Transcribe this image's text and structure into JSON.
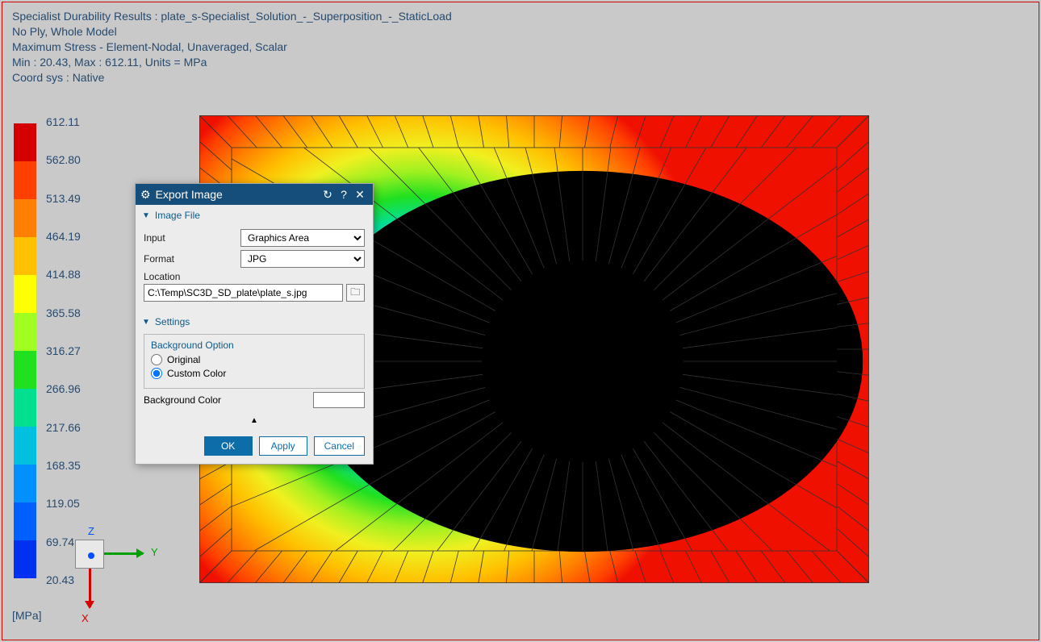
{
  "header": {
    "line1": "Specialist Durability Results : plate_s-Specialist_Solution_-_Superposition_-_StaticLoad",
    "line2": "No Ply, Whole Model",
    "line3": "Maximum Stress - Element-Nodal, Unaveraged, Scalar",
    "line4": "Min : 20.43, Max : 612.11, Units = MPa",
    "line5": "Coord sys : Native"
  },
  "legend": {
    "unit": "[MPa]",
    "values": [
      "612.11",
      "562.80",
      "513.49",
      "464.19",
      "414.88",
      "365.58",
      "316.27",
      "266.96",
      "217.66",
      "168.35",
      "119.05",
      "69.74",
      "20.43"
    ],
    "colors": [
      "#d40000",
      "#ff4000",
      "#ff8000",
      "#ffc000",
      "#ffff00",
      "#a0ff20",
      "#20e020",
      "#00e090",
      "#00c0e0",
      "#0090ff",
      "#0060ff",
      "#0030f0"
    ]
  },
  "triad": {
    "x": "X",
    "y": "Y",
    "z": "Z"
  },
  "dialog": {
    "title": "Export Image",
    "sections": {
      "imageFile": "Image File",
      "settings": "Settings"
    },
    "fields": {
      "inputLabel": "Input",
      "inputValue": "Graphics Area",
      "formatLabel": "Format",
      "formatValue": "JPG",
      "locationLabel": "Location",
      "locationValue": "C:\\Temp\\SC3D_SD_plate\\plate_s.jpg"
    },
    "settings": {
      "groupTitle": "Background Option",
      "original": "Original",
      "custom": "Custom Color",
      "bgColorLabel": "Background Color"
    },
    "buttons": {
      "ok": "OK",
      "apply": "Apply",
      "cancel": "Cancel"
    }
  }
}
